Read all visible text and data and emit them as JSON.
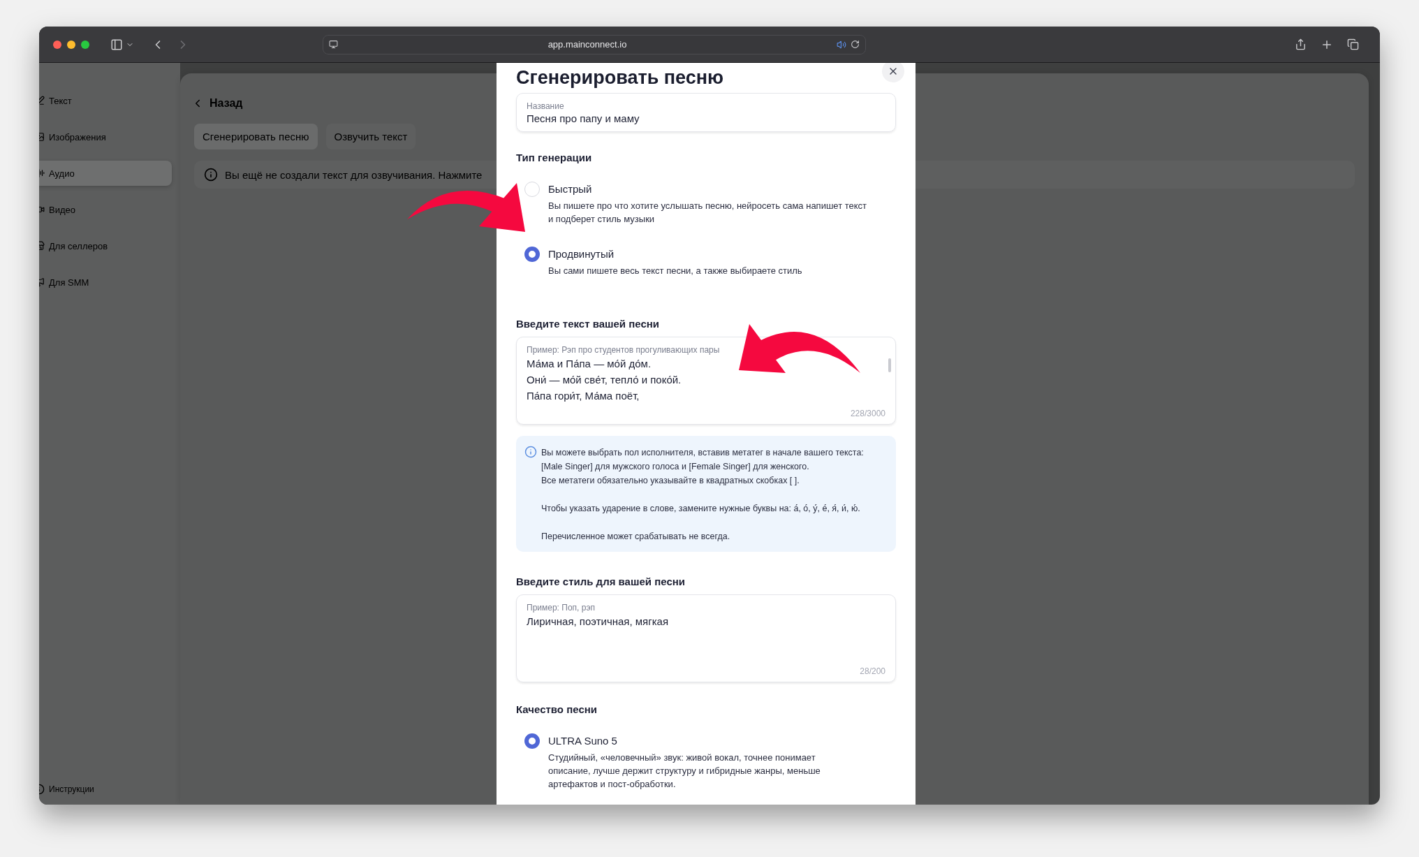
{
  "browser": {
    "url": "app.mainconnect.io"
  },
  "sidebar": {
    "items": [
      {
        "kind": "text",
        "label": "Текст",
        "selected": false
      },
      {
        "kind": "image",
        "label": "Изображения",
        "selected": false
      },
      {
        "kind": "audio",
        "label": "Аудио",
        "selected": true
      },
      {
        "kind": "video",
        "label": "Видео",
        "selected": false
      },
      {
        "kind": "sellers",
        "label": "Для селлеров",
        "selected": false
      },
      {
        "kind": "smm",
        "label": "Для SMM",
        "selected": false
      }
    ],
    "footer": "Инструкции"
  },
  "main": {
    "back": "Назад",
    "tabs": [
      {
        "label": "Сгенерировать песню",
        "selected": true
      },
      {
        "label": "Озвучить текст",
        "selected": false
      }
    ],
    "notice": "Вы ещё не создали текст для озвучивания. Нажмите"
  },
  "dialog": {
    "title": "Сгенерировать песню",
    "name_field": {
      "label": "Название",
      "value": "Песня про папу и маму"
    },
    "generation_type": {
      "label": "Тип генерации",
      "options": [
        {
          "title": "Быстрый",
          "description": "Вы пишете про что хотите услышать песню, нейросеть сама напишет текст и подберет стиль музыки",
          "selected": false
        },
        {
          "title": "Продвинутый",
          "description": "Вы сами пишете весь текст песни, а также выбираете стиль",
          "selected": true
        }
      ]
    },
    "lyrics": {
      "label": "Введите текст вашей песни",
      "example": "Пример: Рэп про студентов прогуливающих пары",
      "lines": [
        "Ма́ма и Па́па — мо́й до́м.",
        "Они́ — мо́й све́т, тепло́ и поко́й.",
        "Па́па гори́т, Ма́ма поёт,"
      ],
      "counter": "228/3000"
    },
    "hint": {
      "paragraphs": [
        [
          "Вы можете выбрать пол исполнителя, вставив метатег в начале вашего текста:",
          "[Male Singer] для мужского голоса и [Female Singer] для женского.",
          "Все метатеги обязательно указывайте в квадратных скобках [ ]."
        ],
        [
          "Чтобы указать ударение в слове, замените нужные буквы на: а́, о́, у́, е́, я́, и́, ю́."
        ],
        [
          "Перечисленное может срабатывать не всегда."
        ]
      ]
    },
    "style": {
      "label": "Введите стиль для вашей песни",
      "example": "Пример: Поп, рэп",
      "value": "Лиричная, поэтичная, мягкая",
      "counter": "28/200"
    },
    "quality": {
      "label": "Качество песни",
      "options": [
        {
          "title": "ULTRA Suno 5",
          "description": "Студийный, «человечный» звук: живой вокал, точнее понимает описание, лучше держит структуру и гибридные жанры, меньше артефактов и пост-обработки.",
          "selected": true
        }
      ]
    }
  }
}
